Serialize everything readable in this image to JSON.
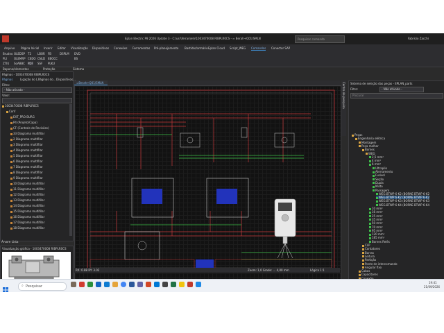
{
  "app": {
    "title": "Eplan Electric P8 2026 Update 3 - C:\\usr\\ferran\\eln\\1003470008 RIBPLR0CS - ≈ Berah+Q01/SMLN",
    "user": "Fabricio Zacchi",
    "search_placeholder": "Pesquisar comando"
  },
  "menu": [
    "Arquivo",
    "Página Inicial",
    "Inserir",
    "Editar",
    "Visualização",
    "Dispositivos",
    "Conexões",
    "Ferramentas",
    "Pré-planejamento",
    "Bastidor/armário",
    "Eplan Cloud",
    "Script_WEG",
    "Comandos",
    "Conector SAP"
  ],
  "ribbon_rows": [
    [
      "Brudno",
      "OLEDSP",
      "T2",
      "LBOR",
      "FB",
      "DSPLM",
      "DVD"
    ],
    [
      "PLI",
      "OLEMRP",
      "CEDO",
      "CNLD",
      "EBOCC",
      "BS"
    ],
    [
      "ZTIU",
      "SoABBC",
      "PDF",
      "SSF",
      "PLKU"
    ]
  ],
  "left_panel": {
    "title": "Páginas - 1003470008 RIBPLR0CS",
    "tabs": [
      "Páginas",
      "Ligação do L...",
      "Páginas do...",
      "Dispositivos..."
    ],
    "filter_label": "Filtro:",
    "filter_value": "- Não ativado -",
    "value_label": "Valor:",
    "tree": [
      "1003470008 RIBPLR0CS",
      "Conf",
      "EXT_PRO BURG",
      "P4 (Projeto/Capa)",
      "CF (Controle de Revisões)",
      "33 Diagrama multifilar",
      "2 Diagrama multifilar",
      "3 Diagrama multifilar",
      "4 Diagrama multifilar",
      "5 Diagrama multifilar",
      "6 Diagrama multifilar",
      "7 Diagrama multifilar",
      "8 Diagrama multifilar",
      "9 Diagrama multifilar",
      "10 Diagrama multifilar",
      "11 Diagrama multifilar",
      "12 Diagrama multifilar",
      "13 Diagrama multifilar",
      "14 Diagrama multifilar",
      "15 Diagrama multifilar",
      "16 Diagrama multifilar",
      "17 Diagrama multifilar",
      "18 Diagrama multifilar"
    ],
    "bottom_tabs": [
      "Árvore",
      "Lista"
    ],
    "preview_title": "Visualização gráfica - 1003470008 RIBPLR0CS",
    "splitbar_labels": [
      "Bapone/elementos",
      "Proteção"
    ],
    "splitbar_right": "Sistema"
  },
  "canvas": {
    "tab_label": "=Berah+Q01/SMLN",
    "status_left": "RX: 0.88 RY: 3.02",
    "status_right": "Zoom: 1,0 Grade: ... 4,00 mm",
    "logica": "Lógica 1:1"
  },
  "right_panel": {
    "title": "Sistema de seleção das peças - EPLAN_parts",
    "filter_label": "Filtro:",
    "filter_value": "- Não ativado -",
    "search_placeholder": "Procurar",
    "side_tab": "Centro de pesquisa",
    "tree": [
      {
        "t": "Peças",
        "l": 0,
        "hl": false
      },
      {
        "t": "Engenharia elétrica",
        "l": 1,
        "hl": false
      },
      {
        "t": "Montagem",
        "l": 2,
        "hl": false
      },
      {
        "t": "Peça malhar",
        "l": 2,
        "hl": false
      },
      {
        "t": "Bornes",
        "l": 3,
        "hl": false
      },
      {
        "t": "WEG",
        "l": 4,
        "hl": false
      },
      {
        "t": "2,5 mm²",
        "l": 5,
        "hl": false
      },
      {
        "t": "4 mm²",
        "l": 5,
        "hl": false
      },
      {
        "t": "6 mm²",
        "l": 5,
        "hl": false
      },
      {
        "t": "Ultrapilo",
        "l": 6,
        "hl": false
      },
      {
        "t": "Aterramento",
        "l": 6,
        "hl": false
      },
      {
        "t": "Fusível",
        "l": 6,
        "hl": false
      },
      {
        "t": "Seção",
        "l": 6,
        "hl": false
      },
      {
        "t": "Dupla",
        "l": 6,
        "hl": false
      },
      {
        "t": "Misto",
        "l": 6,
        "hl": false
      },
      {
        "t": "Passagem",
        "l": 6,
        "hl": false
      },
      {
        "t": "WEG.BTWP 6-K2 (BORNE BTWP 6-K2",
        "l": 7,
        "hl": false
      },
      {
        "t": "WEG.BTWP 6-K2 (BORNE BTWP 6-K2",
        "l": 7,
        "hl": true
      },
      {
        "t": "WEG.BTWP 6-K3 (BORNE BTWP 6-K3",
        "l": 7,
        "hl": false
      },
      {
        "t": "WEG.BTWP 6-K4 (BORNE BTWP 6-K4",
        "l": 7,
        "hl": false
      },
      {
        "t": "10 mm²",
        "l": 5,
        "hl": false
      },
      {
        "t": "16 mm²",
        "l": 5,
        "hl": false
      },
      {
        "t": "25 mm²",
        "l": 5,
        "hl": false
      },
      {
        "t": "35 mm²",
        "l": 5,
        "hl": false
      },
      {
        "t": "50 mm²",
        "l": 5,
        "hl": false
      },
      {
        "t": "70 mm²",
        "l": 5,
        "hl": false
      },
      {
        "t": "95 mm²",
        "l": 5,
        "hl": false
      },
      {
        "t": "120 mm²",
        "l": 5,
        "hl": false
      },
      {
        "t": "185 mm²",
        "l": 5,
        "hl": false
      },
      {
        "t": "Bornes Relés",
        "l": 5,
        "hl": false
      },
      {
        "t": "CLP",
        "l": 3,
        "hl": false
      },
      {
        "t": "Contatores",
        "l": 3,
        "hl": false
      },
      {
        "t": "Barras",
        "l": 3,
        "hl": false
      },
      {
        "t": "Leitura",
        "l": 3,
        "hl": false
      },
      {
        "t": "Partição",
        "l": 3,
        "hl": false
      },
      {
        "t": "Ponte de intercomando",
        "l": 3,
        "hl": false
      },
      {
        "t": "Angular fixo",
        "l": 3,
        "hl": false
      },
      {
        "t": "Cabos",
        "l": 2,
        "hl": false
      },
      {
        "t": "Capacitores",
        "l": 2,
        "hl": false
      },
      {
        "t": "Conexão",
        "l": 2,
        "hl": false
      },
      {
        "t": "Conversor",
        "l": 2,
        "hl": false
      }
    ]
  },
  "taskbar": {
    "search_placeholder": "Pesquisar",
    "time": "19:41",
    "date": "21/09/2026"
  },
  "colors": {
    "accent": "#3f8fd2",
    "canvas_bg": "#121212",
    "wire_red": "#c8383a",
    "wire_green": "#3ec24a",
    "component_blue": "#2233bb"
  }
}
